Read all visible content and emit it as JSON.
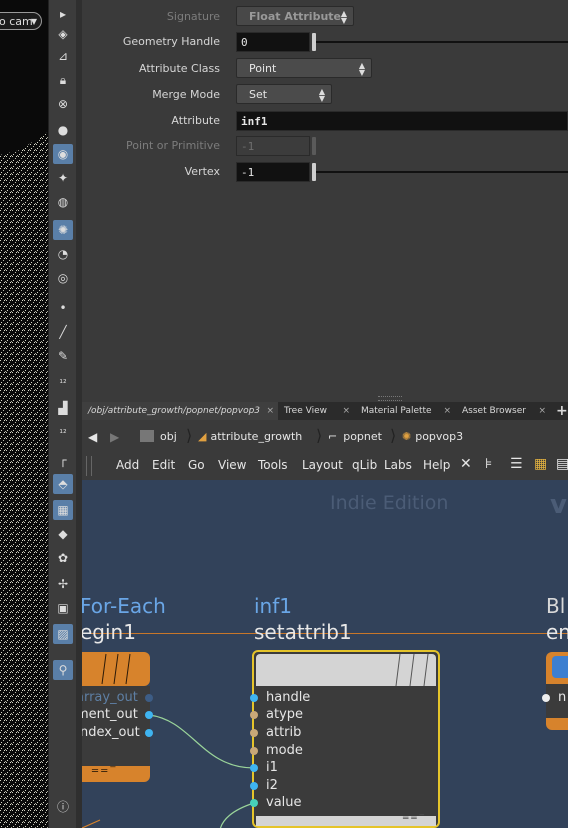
{
  "viewport": {
    "camera_label": "o cam",
    "tools": [
      "select",
      "cursor",
      "lock",
      "x-ray",
      "sphere",
      "camera-light",
      "light",
      "light-point",
      "geo-light",
      "env-light",
      "spotlight",
      "area-light",
      "distant-light",
      "dot",
      "brush",
      "pencil",
      "key",
      "num-12",
      "bucket",
      "num-12b",
      "corner",
      "move",
      "pan",
      "rotate",
      "flag",
      "flag2",
      "globe",
      "image",
      "pin",
      "info"
    ]
  },
  "params": {
    "signature": {
      "label": "Signature",
      "value": "Float Attribute"
    },
    "geometry_handle": {
      "label": "Geometry Handle",
      "value": "0"
    },
    "attribute_class": {
      "label": "Attribute Class",
      "value": "Point"
    },
    "merge_mode": {
      "label": "Merge Mode",
      "value": "Set"
    },
    "attribute": {
      "label": "Attribute",
      "value": "inf1"
    },
    "point_or_primitive": {
      "label": "Point or Primitive",
      "value": "-1"
    },
    "vertex": {
      "label": "Vertex",
      "value": "-1"
    }
  },
  "tabs": [
    {
      "label": "/obj/attribute_growth/popnet/popvop3",
      "close": "×"
    },
    {
      "label": "Tree View",
      "close": "×"
    },
    {
      "label": "Material Palette",
      "close": "×"
    },
    {
      "label": "Asset Browser",
      "close": "×"
    }
  ],
  "tabs_add": "+",
  "path": {
    "back": "◀",
    "forward": "▶",
    "items": [
      "obj",
      "attribute_growth",
      "popnet",
      "popvop3"
    ]
  },
  "menus": [
    "Add",
    "Edit",
    "Go",
    "View",
    "Tools",
    "Layout",
    "qLib",
    "Labs",
    "Help"
  ],
  "network": {
    "watermark": "Indie Edition",
    "watermark_right": "v",
    "left_node": {
      "title1": "For-Each",
      "title2": "egin1",
      "outputs": [
        "array_out",
        "ment_out",
        "ndex_out"
      ]
    },
    "center_node": {
      "title1": "inf1",
      "title2": "setattrib1",
      "inputs": [
        "handle",
        "atype",
        "attrib",
        "mode",
        "i1",
        "i2",
        "value"
      ]
    },
    "right_node": {
      "title1": "Bl",
      "title2": "en",
      "port": "n"
    }
  },
  "colors": {
    "accent_blue": "#6aa6e6",
    "orange": "#d7832c",
    "selected_yellow": "#e5c42a",
    "network_bg": "#32425a"
  }
}
